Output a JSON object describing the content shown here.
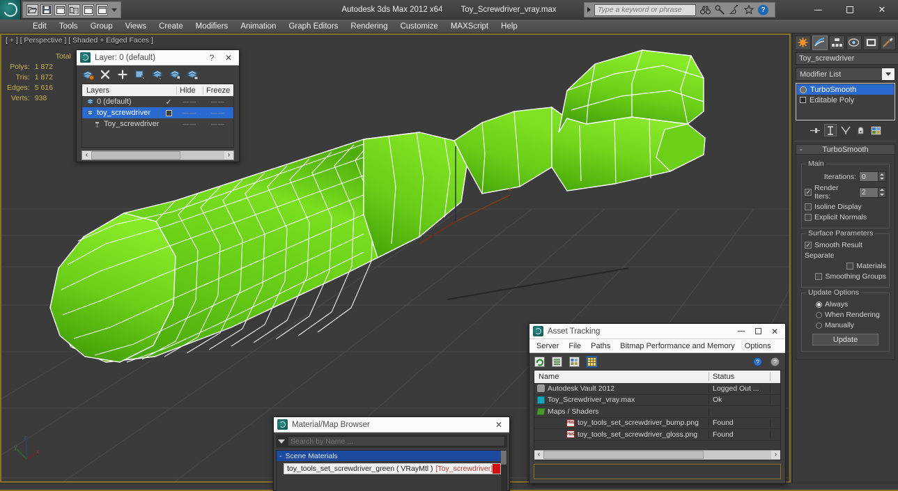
{
  "app": {
    "title": "Autodesk 3ds Max  2012 x64",
    "file": "Toy_Screwdriver_vray.max"
  },
  "quick_access": {
    "items": [
      {
        "name": "open-file-icon",
        "label": "Open File"
      },
      {
        "name": "save-file-icon",
        "label": "Save File"
      },
      {
        "name": "new-scene-icon",
        "label": "New Scene"
      },
      {
        "name": "set-project-folder-icon",
        "label": "Set Project Folder"
      },
      {
        "name": "undo-icon",
        "label": "Undo"
      },
      {
        "name": "redo-icon",
        "label": "Redo"
      }
    ]
  },
  "search": {
    "placeholder": "Type a keyword or phrase",
    "value": "",
    "icons": [
      "binoculars-icon",
      "wrench-icon",
      "satellite-dish-icon",
      "star-icon",
      "help-icon"
    ]
  },
  "window_controls": {
    "minimize": "minimize-icon",
    "maximize": "maximize-icon",
    "close": "close-icon"
  },
  "menu": {
    "items": [
      "Edit",
      "Tools",
      "Group",
      "Views",
      "Create",
      "Modifiers",
      "Animation",
      "Graph Editors",
      "Rendering",
      "Customize",
      "MAXScript",
      "Help"
    ]
  },
  "viewport": {
    "label": "[ + ] [ Perspective ] [ Shaded + Edged Faces ]",
    "stats": {
      "header": "Total",
      "rows": [
        {
          "label": "Polys:",
          "value": "1 872"
        },
        {
          "label": "Tris:",
          "value": "1 872"
        },
        {
          "label": "Edges:",
          "value": "5 616"
        },
        {
          "label": "Verts:",
          "value": "938"
        }
      ]
    },
    "axis_gizmo": {
      "x": "x",
      "y": "y",
      "z": "z"
    },
    "colors": {
      "background": "#3b3b3b",
      "grid": "#4a4a4a",
      "object_green": "#5fc414",
      "wireframe": "#ffffff",
      "active_border": "#8a7228"
    }
  },
  "layer_dialog": {
    "title": "Layer: 0 (default)",
    "help_label": "?",
    "close_label": "✕",
    "toolbar": [
      {
        "name": "create-new-layer-icon",
        "label": "Create New Layer"
      },
      {
        "name": "delete-highlighted-layer-icon",
        "label": "Delete Highlighted Empty Layers"
      },
      {
        "name": "add-selected-objects-icon",
        "label": "Add Selected Objects to Highlighted Layer"
      },
      {
        "name": "select-objects-in-layer-icon",
        "label": "Select Objects in Highlighted Layers"
      },
      {
        "name": "highlight-selected-objects-layer-icon",
        "label": "Highlight Selected Objects Layers"
      },
      {
        "name": "set-current-layer-to-selection-icon",
        "label": "Set Current Layer to Selection's Layer"
      },
      {
        "name": "hide-unhide-layer-icon",
        "label": "Hide / Unhide"
      }
    ],
    "columns": [
      "Layers",
      "Hide",
      "Freeze"
    ],
    "rows": [
      {
        "name": "0 (default)",
        "indent": 0,
        "current": true,
        "check": "✓",
        "hide": "——",
        "freeze": "——",
        "selected": false,
        "icon": "layer-icon"
      },
      {
        "name": "toy_screwdriver",
        "indent": 0,
        "current": false,
        "check": "",
        "hide": "——",
        "freeze": "——",
        "selected": true,
        "icon": "layer-icon"
      },
      {
        "name": "Toy_screwdriver",
        "indent": 1,
        "current": false,
        "check": "",
        "hide": "——",
        "freeze": "——",
        "selected": false,
        "icon": "object-icon"
      }
    ],
    "scroll": {
      "left_arrow": "‹",
      "right_arrow": "›"
    }
  },
  "material_browser": {
    "title": "Material/Map Browser",
    "close_label": "✕",
    "search_placeholder": "Search by Name ...",
    "search_value": "",
    "group": {
      "collapse": "-",
      "label": "Scene Materials"
    },
    "entry": {
      "name": "toy_tools_set_screwdriver_green ( VRayMtl )",
      "object": "[Toy_screwdriver]",
      "swatch_color": "#cf1111"
    }
  },
  "asset_tracking": {
    "title": "Asset Tracking",
    "window_controls": {
      "minimize": "–",
      "maximize": "☐",
      "close": "✕"
    },
    "menu": [
      "Server",
      "File",
      "Paths",
      "Bitmap Performance and Memory",
      "Options"
    ],
    "toolbar": [
      {
        "name": "refresh-icon",
        "label": "Refresh"
      },
      {
        "name": "list-view-icon",
        "label": "List View"
      },
      {
        "name": "thumbnail-view-icon",
        "label": "Thumbnail View"
      },
      {
        "name": "grid-view-icon",
        "label": "Grid View",
        "active": true
      },
      {
        "name": "help-vault-icon",
        "label": "Help"
      },
      {
        "name": "help-about-icon",
        "label": "About"
      }
    ],
    "columns": [
      "Name",
      "Status"
    ],
    "rows": [
      {
        "name": "Autodesk Vault 2012",
        "status": "Logged Out ...",
        "indent": 0,
        "icon": "vault-icon"
      },
      {
        "name": "Toy_Screwdriver_vray.max",
        "status": "Ok",
        "indent": 1,
        "icon": "max-file-icon"
      },
      {
        "name": "Maps / Shaders",
        "status": "",
        "indent": 2,
        "icon": "maps-shaders-icon"
      },
      {
        "name": "toy_tools_set_screwdriver_bump.png",
        "status": "Found",
        "indent": 3,
        "icon": "png-icon"
      },
      {
        "name": "toy_tools_set_screwdriver_gloss.png",
        "status": "Found",
        "indent": 3,
        "icon": "png-icon"
      }
    ],
    "scroll": {
      "left_arrow": "‹",
      "right_arrow": "›"
    },
    "status_bar": ""
  },
  "command_panel": {
    "tabs": [
      {
        "name": "create-tab",
        "label": "Create",
        "selected": false
      },
      {
        "name": "modify-tab",
        "label": "Modify",
        "selected": true
      },
      {
        "name": "hierarchy-tab",
        "label": "Hierarchy",
        "selected": false
      },
      {
        "name": "motion-tab",
        "label": "Motion",
        "selected": false
      },
      {
        "name": "display-tab",
        "label": "Display",
        "selected": false
      },
      {
        "name": "utilities-tab",
        "label": "Utilities",
        "selected": false
      }
    ],
    "object_name": "Toy_screwdriver",
    "object_color": "#5fd6b0",
    "modifier_list_label": "Modifier List",
    "modifier_stack": [
      {
        "label": "TurboSmooth",
        "selected": true,
        "icon": "lightbulb-icon"
      },
      {
        "label": "Editable Poly",
        "selected": false,
        "icon": "poly-icon"
      }
    ],
    "stack_buttons": [
      {
        "name": "pin-stack-icon",
        "label": "Pin Stack"
      },
      {
        "name": "show-end-result-icon",
        "label": "Show End Result",
        "active": true
      },
      {
        "name": "make-unique-icon",
        "label": "Make Unique"
      },
      {
        "name": "remove-modifier-icon",
        "label": "Remove Modifier from the Stack"
      },
      {
        "name": "configure-modifier-sets-icon",
        "label": "Configure Modifier Sets"
      }
    ],
    "rollout": {
      "collapse": "-",
      "title": "TurboSmooth",
      "main": {
        "label": "Main",
        "iterations_label": "Iterations:",
        "iterations_value": "0",
        "render_iters_label": "Render Iters:",
        "render_iters_value": "2",
        "render_iters_checked": true,
        "isoline_display_label": "Isoline Display",
        "isoline_display_checked": false,
        "explicit_normals_label": "Explicit Normals",
        "explicit_normals_checked": false
      },
      "surface": {
        "label": "Surface Parameters",
        "smooth_result_label": "Smooth Result",
        "smooth_result_checked": true,
        "separate_label": "Separate",
        "materials_label": "Materials",
        "materials_checked": false,
        "smoothing_groups_label": "Smoothing Groups",
        "smoothing_groups_checked": false
      },
      "update": {
        "label": "Update Options",
        "options": [
          {
            "label": "Always",
            "selected": true
          },
          {
            "label": "When Rendering",
            "selected": false
          },
          {
            "label": "Manually",
            "selected": false
          }
        ],
        "button_label": "Update"
      }
    }
  }
}
